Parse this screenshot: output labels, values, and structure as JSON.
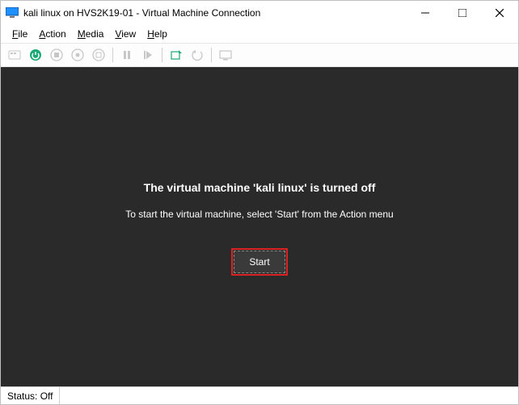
{
  "titlebar": {
    "title": "kali linux on HVS2K19-01 - Virtual Machine Connection"
  },
  "menu": {
    "file": "File",
    "action": "Action",
    "media": "Media",
    "view": "View",
    "help": "Help"
  },
  "toolbar_icons": {
    "ctrl_alt_del": "ctrl-alt-del-icon",
    "start": "start-icon",
    "turnoff": "turn-off-icon",
    "shutdown": "shutdown-icon",
    "save": "save-icon",
    "pause": "pause-icon",
    "reset": "reset-icon",
    "checkpoint": "checkpoint-icon",
    "revert": "revert-icon",
    "enhanced": "enhanced-session-icon"
  },
  "content": {
    "headline": "The virtual machine 'kali linux' is turned off",
    "subline": "To start the virtual machine, select 'Start' from the Action menu",
    "start_label": "Start"
  },
  "statusbar": {
    "status": "Status: Off"
  }
}
